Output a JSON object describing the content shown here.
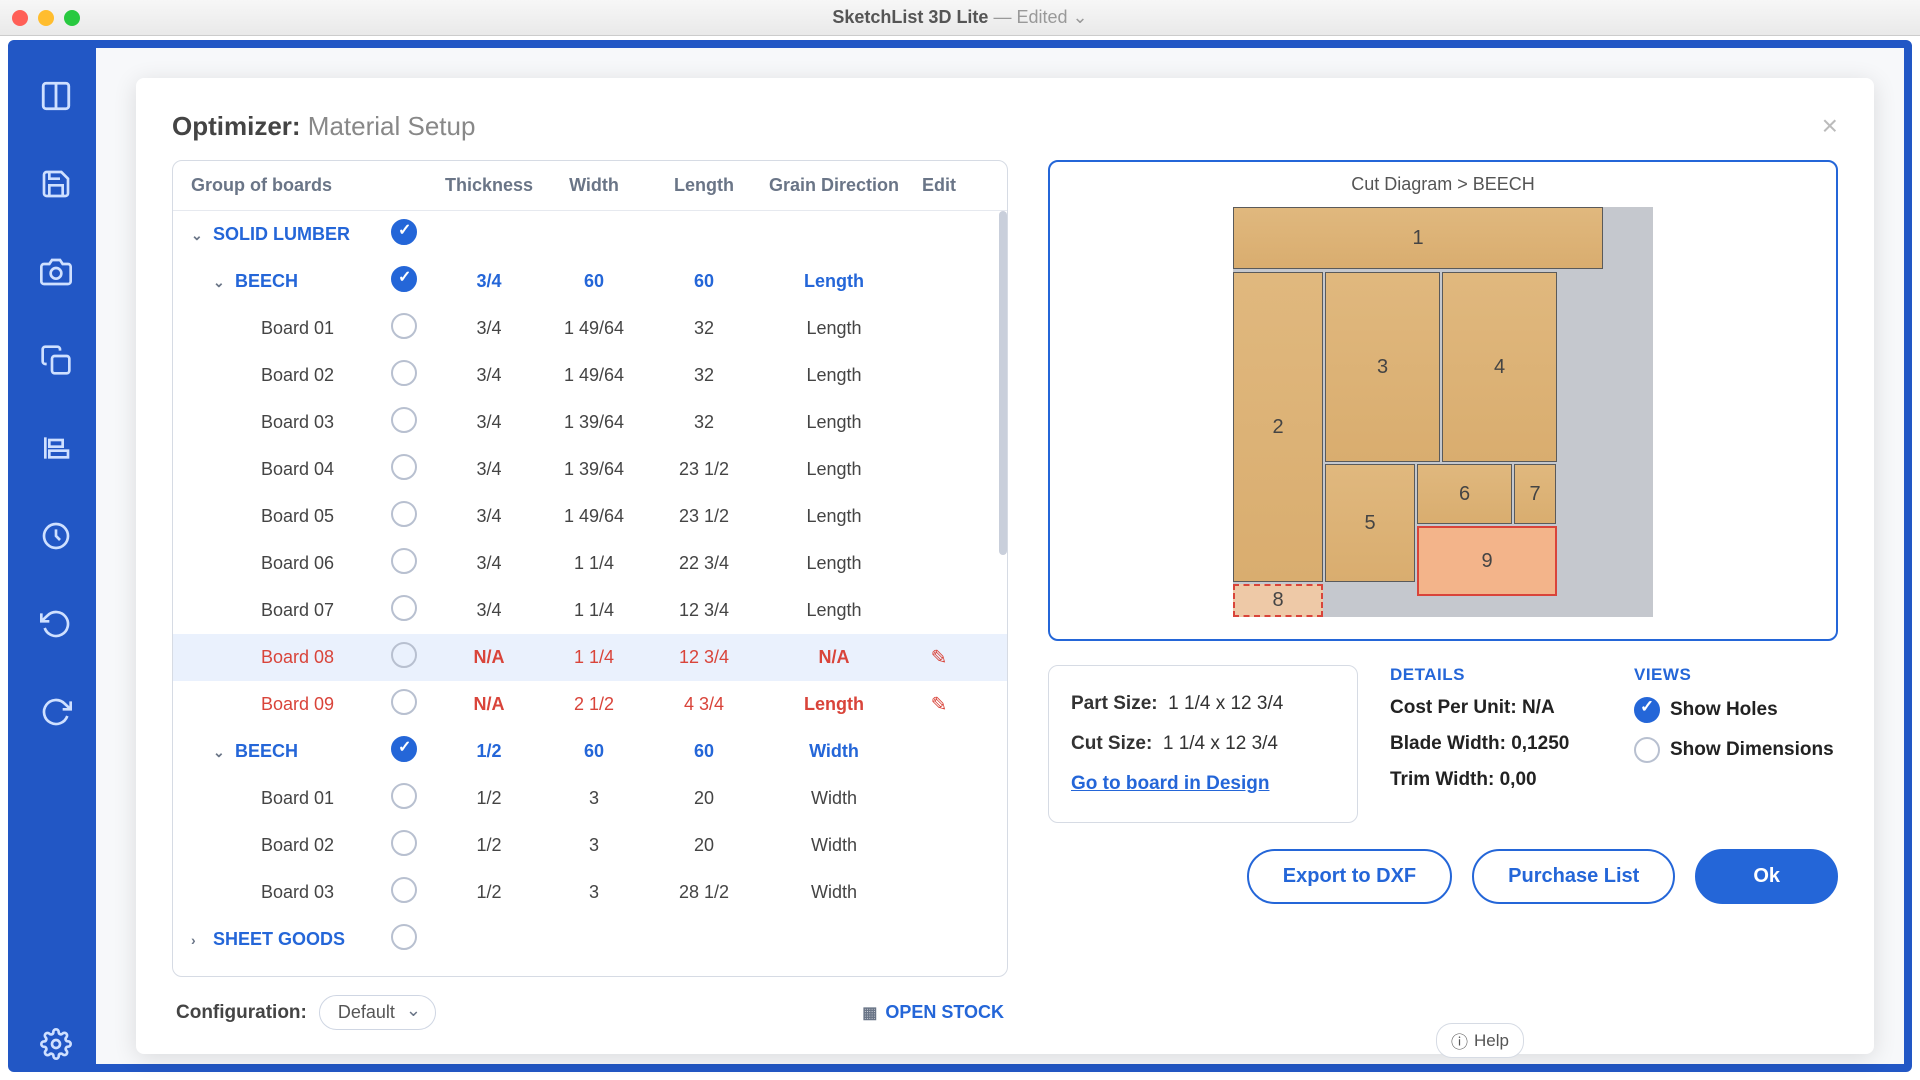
{
  "app": {
    "title": "SketchList 3D Lite",
    "edited": " — Edited"
  },
  "dialog": {
    "prefix": "Optimizer:",
    "title": " Material Setup"
  },
  "columns": {
    "name": "Group of boards",
    "thickness": "Thickness",
    "width": "Width",
    "length": "Length",
    "grain": "Grain Direction",
    "edit": "Edit"
  },
  "groups": {
    "solid": {
      "label": "SOLID LUMBER",
      "checked": true
    },
    "beech1": {
      "label": "BEECH",
      "checked": true,
      "t": "3/4",
      "w": "60",
      "l": "60",
      "g": "Length"
    },
    "beech1_boards": [
      {
        "name": "Board 01",
        "t": "3/4",
        "w": "1 49/64",
        "l": "32",
        "g": "Length"
      },
      {
        "name": "Board 02",
        "t": "3/4",
        "w": "1 49/64",
        "l": "32",
        "g": "Length"
      },
      {
        "name": "Board 03",
        "t": "3/4",
        "w": "1 39/64",
        "l": "32",
        "g": "Length"
      },
      {
        "name": "Board 04",
        "t": "3/4",
        "w": "1 39/64",
        "l": "23 1/2",
        "g": "Length"
      },
      {
        "name": "Board 05",
        "t": "3/4",
        "w": "1 49/64",
        "l": "23 1/2",
        "g": "Length"
      },
      {
        "name": "Board 06",
        "t": "3/4",
        "w": "1 1/4",
        "l": "22 3/4",
        "g": "Length"
      },
      {
        "name": "Board 07",
        "t": "3/4",
        "w": "1 1/4",
        "l": "12 3/4",
        "g": "Length"
      },
      {
        "name": "Board 08",
        "t": "N/A",
        "w": "1 1/4",
        "l": "12 3/4",
        "g": "N/A",
        "error": true,
        "edit": true,
        "selected": true
      },
      {
        "name": "Board 09",
        "t": "N/A",
        "w": "2 1/2",
        "l": "4 3/4",
        "g": "Length",
        "error": true,
        "edit": true
      }
    ],
    "beech2": {
      "label": "BEECH",
      "checked": true,
      "t": "1/2",
      "w": "60",
      "l": "60",
      "g": "Width"
    },
    "beech2_boards": [
      {
        "name": "Board 01",
        "t": "1/2",
        "w": "3",
        "l": "20",
        "g": "Width"
      },
      {
        "name": "Board 02",
        "t": "1/2",
        "w": "3",
        "l": "20",
        "g": "Width"
      },
      {
        "name": "Board 03",
        "t": "1/2",
        "w": "3",
        "l": "28 1/2",
        "g": "Width"
      }
    ],
    "sheet": {
      "label": "SHEET GOODS"
    }
  },
  "config": {
    "label": "Configuration:",
    "value": "Default"
  },
  "openstock": "OPEN STOCK",
  "cut": {
    "title": "Cut Diagram  > BEECH",
    "pieces": {
      "p1": "1",
      "p2": "2",
      "p3": "3",
      "p4": "4",
      "p5": "5",
      "p6": "6",
      "p7": "7",
      "p8": "8",
      "p9": "9"
    }
  },
  "info": {
    "part_label": "Part Size:",
    "part_val": "1 1/4 x 12 3/4",
    "cut_label": "Cut Size:",
    "cut_val": "1 1/4 x 12 3/4",
    "link": "Go to board in Design"
  },
  "details": {
    "head": "DETAILS",
    "cost": "Cost Per Unit: N/A",
    "blade": "Blade Width: 0,1250",
    "trim": "Trim Width: 0,00"
  },
  "views": {
    "head": "VIEWS",
    "holes": "Show Holes",
    "dims": "Show Dimensions"
  },
  "buttons": {
    "dxf": "Export to DXF",
    "purchase": "Purchase List",
    "ok": "Ok"
  },
  "help": "Help"
}
